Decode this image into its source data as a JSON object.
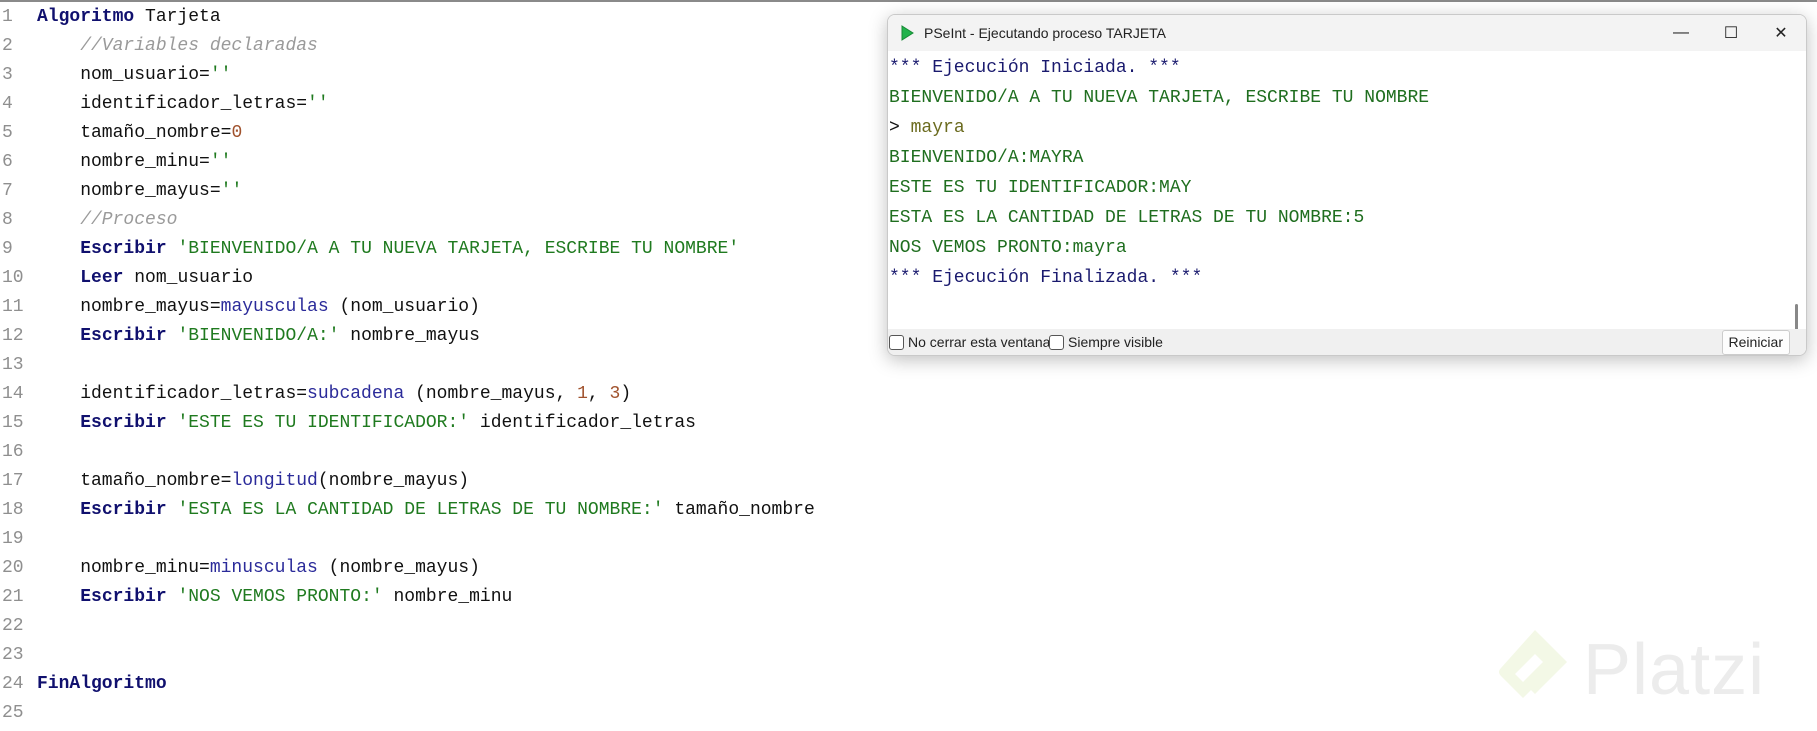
{
  "editor": {
    "lines": [
      {
        "n": "1",
        "tokens": [
          {
            "t": "Algoritmo",
            "c": "kw"
          },
          {
            "t": " Tarjeta",
            "c": "id"
          }
        ]
      },
      {
        "n": "2",
        "tokens": [
          {
            "t": "    //Variables declaradas",
            "c": "com"
          }
        ]
      },
      {
        "n": "3",
        "tokens": [
          {
            "t": "    nom_usuario=",
            "c": "id"
          },
          {
            "t": "''",
            "c": "str"
          }
        ]
      },
      {
        "n": "4",
        "tokens": [
          {
            "t": "    identificador_letras=",
            "c": "id"
          },
          {
            "t": "''",
            "c": "str"
          }
        ]
      },
      {
        "n": "5",
        "tokens": [
          {
            "t": "    tamaño_nombre=",
            "c": "id"
          },
          {
            "t": "0",
            "c": "num"
          }
        ]
      },
      {
        "n": "6",
        "tokens": [
          {
            "t": "    nombre_minu=",
            "c": "id"
          },
          {
            "t": "''",
            "c": "str"
          }
        ]
      },
      {
        "n": "7",
        "tokens": [
          {
            "t": "    nombre_mayus=",
            "c": "id"
          },
          {
            "t": "''",
            "c": "str"
          }
        ]
      },
      {
        "n": "8",
        "tokens": [
          {
            "t": "    //Proceso",
            "c": "com"
          }
        ]
      },
      {
        "n": "9",
        "tokens": [
          {
            "t": "    ",
            "c": "id"
          },
          {
            "t": "Escribir",
            "c": "kw"
          },
          {
            "t": " 'BIENVENIDO/A A TU NUEVA TARJETA, ESCRIBE TU NOMBRE'",
            "c": "str"
          }
        ]
      },
      {
        "n": "10",
        "tokens": [
          {
            "t": "    ",
            "c": "id"
          },
          {
            "t": "Leer",
            "c": "kw"
          },
          {
            "t": " nom_usuario",
            "c": "id"
          }
        ]
      },
      {
        "n": "11",
        "tokens": [
          {
            "t": "    nombre_mayus=",
            "c": "id"
          },
          {
            "t": "mayusculas",
            "c": "fn"
          },
          {
            "t": " (nom_usuario)",
            "c": "id"
          }
        ]
      },
      {
        "n": "12",
        "tokens": [
          {
            "t": "    ",
            "c": "id"
          },
          {
            "t": "Escribir",
            "c": "kw"
          },
          {
            "t": " 'BIENVENIDO/A:'",
            "c": "str"
          },
          {
            "t": " nombre_mayus",
            "c": "id"
          }
        ]
      },
      {
        "n": "13",
        "tokens": []
      },
      {
        "n": "14",
        "tokens": [
          {
            "t": "    identificador_letras=",
            "c": "id"
          },
          {
            "t": "subcadena",
            "c": "fn"
          },
          {
            "t": " (nombre_mayus, ",
            "c": "id"
          },
          {
            "t": "1",
            "c": "num"
          },
          {
            "t": ", ",
            "c": "id"
          },
          {
            "t": "3",
            "c": "num"
          },
          {
            "t": ")",
            "c": "id"
          }
        ]
      },
      {
        "n": "15",
        "tokens": [
          {
            "t": "    ",
            "c": "id"
          },
          {
            "t": "Escribir",
            "c": "kw"
          },
          {
            "t": " 'ESTE ES TU IDENTIFICADOR:'",
            "c": "str"
          },
          {
            "t": " identificador_letras",
            "c": "id"
          }
        ]
      },
      {
        "n": "16",
        "tokens": []
      },
      {
        "n": "17",
        "tokens": [
          {
            "t": "    tamaño_nombre=",
            "c": "id"
          },
          {
            "t": "longitud",
            "c": "fn"
          },
          {
            "t": "(nombre_mayus)",
            "c": "id"
          }
        ]
      },
      {
        "n": "18",
        "tokens": [
          {
            "t": "    ",
            "c": "id"
          },
          {
            "t": "Escribir",
            "c": "kw"
          },
          {
            "t": " 'ESTA ES LA CANTIDAD DE LETRAS DE TU NOMBRE:'",
            "c": "str"
          },
          {
            "t": " tamaño_nombre",
            "c": "id"
          }
        ]
      },
      {
        "n": "19",
        "tokens": []
      },
      {
        "n": "20",
        "tokens": [
          {
            "t": "    nombre_minu=",
            "c": "id"
          },
          {
            "t": "minusculas",
            "c": "fn"
          },
          {
            "t": " (nombre_mayus)",
            "c": "id"
          }
        ]
      },
      {
        "n": "21",
        "tokens": [
          {
            "t": "    ",
            "c": "id"
          },
          {
            "t": "Escribir",
            "c": "kw"
          },
          {
            "t": " 'NOS VEMOS PRONTO:'",
            "c": "str"
          },
          {
            "t": " nombre_minu",
            "c": "id"
          }
        ]
      },
      {
        "n": "22",
        "tokens": []
      },
      {
        "n": "23",
        "tokens": []
      },
      {
        "n": "24",
        "tokens": [
          {
            "t": "FinAlgoritmo",
            "c": "kw"
          }
        ]
      },
      {
        "n": "25",
        "tokens": []
      }
    ]
  },
  "window": {
    "title": "PSeInt - Ejecutando proceso TARJETA",
    "app_icon": "pseint-play-icon",
    "minimize": "—",
    "maximize": "☐",
    "close": "✕",
    "console": [
      {
        "parts": [
          {
            "t": "*** Ejecución Iniciada. ***",
            "c": "sys"
          }
        ]
      },
      {
        "parts": [
          {
            "t": "BIENVENIDO/A A TU NUEVA TARJETA, ESCRIBE TU NOMBRE",
            "c": "out"
          }
        ]
      },
      {
        "parts": [
          {
            "t": "> ",
            "c": "prompt"
          },
          {
            "t": "mayra",
            "c": "inp"
          }
        ]
      },
      {
        "parts": [
          {
            "t": "BIENVENIDO/A:MAYRA",
            "c": "out"
          }
        ]
      },
      {
        "parts": [
          {
            "t": "ESTE ES TU IDENTIFICADOR:MAY",
            "c": "out"
          }
        ]
      },
      {
        "parts": [
          {
            "t": "ESTA ES LA CANTIDAD DE LETRAS DE TU NOMBRE:5",
            "c": "out"
          }
        ]
      },
      {
        "parts": [
          {
            "t": "NOS VEMOS PRONTO:mayra",
            "c": "out"
          }
        ]
      },
      {
        "parts": [
          {
            "t": "*** Ejecución Finalizada. ***",
            "c": "sys"
          }
        ]
      }
    ],
    "no_cerrar_label": "No cerrar esta ventana",
    "siempre_visible_label": "Siempre visible",
    "reiniciar_label": "Reiniciar"
  },
  "watermark": {
    "text": "Platzi"
  },
  "colors": {
    "keyword": "#10106e",
    "string": "#1f7a1f",
    "number": "#a0522d",
    "comment": "#9a9a9a",
    "brand": "#98ca3f"
  }
}
